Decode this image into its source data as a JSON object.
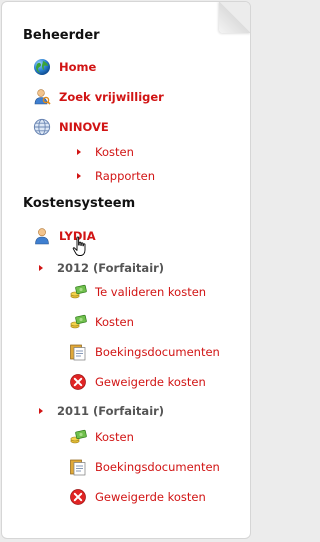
{
  "sections": {
    "beheerder": {
      "title": "Beheerder",
      "items": {
        "home": "Home",
        "zoek": "Zoek vrijwilliger",
        "ninove": "NINOVE",
        "ninove_kosten": "Kosten",
        "ninove_rapporten": "Rapporten"
      }
    },
    "kostensysteem": {
      "title": "Kostensysteem",
      "user": "LYDIA",
      "years": [
        {
          "label": "2012 (Forfaitair)",
          "items": [
            "Te valideren kosten",
            "Kosten",
            "Boekingsdocumenten",
            "Geweigerde kosten"
          ]
        },
        {
          "label": "2011 (Forfaitair)",
          "items": [
            "Kosten",
            "Boekingsdocumenten",
            "Geweigerde kosten"
          ]
        }
      ]
    }
  },
  "colors": {
    "link": "#d11414",
    "heading": "#111111",
    "year": "#555555"
  },
  "icons": {
    "home": "globe-icon",
    "zoek": "user-search-icon",
    "ninove": "network-globe-icon",
    "user": "user-icon",
    "kosten": "money-icon",
    "te_valideren": "money-icon",
    "boekingsdocumenten": "document-icon",
    "geweigerde": "cancel-icon"
  }
}
